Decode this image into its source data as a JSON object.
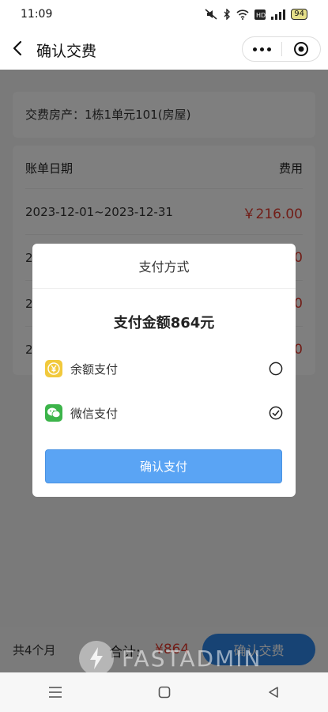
{
  "status_bar": {
    "time": "11:09",
    "battery": "94",
    "indicators": [
      "mute-icon",
      "bluetooth-icon",
      "wifi-icon",
      "hd-icon",
      "signal-icon"
    ]
  },
  "nav": {
    "title": "确认交费"
  },
  "property": {
    "label": "交费房产：1栋1单元101(房屋)"
  },
  "bills": {
    "header_date": "账单日期",
    "header_fee": "费用",
    "rows": [
      {
        "date": "2023-12-01~2023-12-31",
        "amount": "￥216.00"
      },
      {
        "date": "2",
        "amount": "0"
      },
      {
        "date": "2",
        "amount": "0"
      },
      {
        "date": "2",
        "amount": "0"
      }
    ]
  },
  "bottom": {
    "count": "共4个月",
    "total_label": "合计:",
    "total_value": "¥864",
    "confirm_label": "确认交费"
  },
  "watermark": {
    "text": "FASTADMIN"
  },
  "modal": {
    "title": "支付方式",
    "amount_text": "支付金额864元",
    "options": [
      {
        "label": "余额支付",
        "icon": "yuan-icon",
        "icon_color": "#f1c93c",
        "selected": false
      },
      {
        "label": "微信支付",
        "icon": "wechat-icon",
        "icon_color": "#3cb44a",
        "selected": true
      }
    ],
    "confirm_label": "确认支付"
  },
  "colors": {
    "accent_blue": "#2f87e9",
    "price_red": "#e33b2f"
  }
}
